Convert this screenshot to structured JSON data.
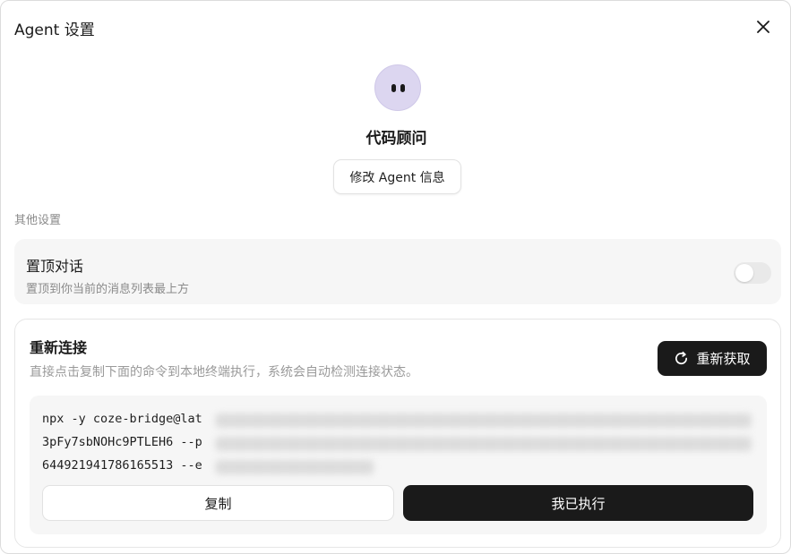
{
  "dialog": {
    "title": "Agent 设置",
    "close_icon": "close-icon"
  },
  "agent": {
    "name": "代码顾问",
    "edit_label": "修改 Agent 信息",
    "avatar_color": "#dcd6f0"
  },
  "other_settings": {
    "label": "其他设置",
    "pin": {
      "title": "置顶对话",
      "description": "置顶到你当前的消息列表最上方",
      "enabled": false
    }
  },
  "reconnect": {
    "title": "重新连接",
    "description": "直接点击复制下面的命令到本地终端执行，系统会自动检测连接状态。",
    "refresh_label": "重新获取",
    "refresh_icon": "refresh-icon",
    "command_lines": [
      "npx -y coze-bridge@lat",
      "3pFy7sbNOHc9PTLEH6 --p",
      "644921941786165513 --e"
    ],
    "copy_label": "复制",
    "done_label": "我已执行"
  }
}
